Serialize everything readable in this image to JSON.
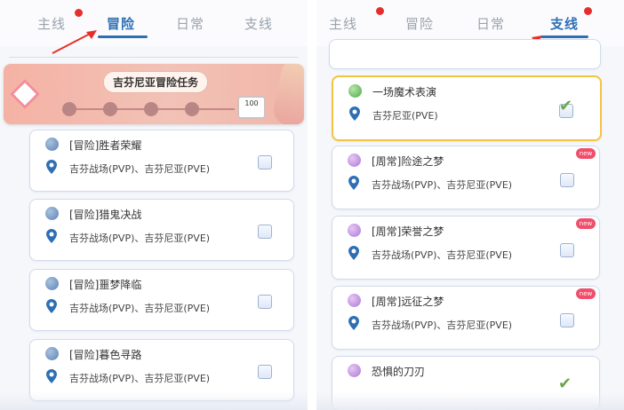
{
  "left": {
    "tabs": [
      {
        "label": "主线",
        "active": false,
        "red_dot": true
      },
      {
        "label": "冒险",
        "active": true,
        "red_dot": false
      },
      {
        "label": "日常",
        "active": false,
        "red_dot": false
      },
      {
        "label": "支线",
        "active": false,
        "red_dot": false
      }
    ],
    "banner": {
      "title": "吉芬尼亚冒险任务",
      "reward": "100"
    },
    "tasks": [
      {
        "title": "[冒险]胜者荣耀",
        "location": "吉芬战场(PVP)、吉芬尼亚(PVE)",
        "done": false
      },
      {
        "title": "[冒险]猎鬼决战",
        "location": "吉芬战场(PVP)、吉芬尼亚(PVE)",
        "done": false
      },
      {
        "title": "[冒险]噩梦降临",
        "location": "吉芬战场(PVP)、吉芬尼亚(PVE)",
        "done": false
      },
      {
        "title": "[冒险]暮色寻路",
        "location": "吉芬战场(PVP)、吉芬尼亚(PVE)",
        "done": false
      }
    ]
  },
  "right": {
    "tabs": [
      {
        "label": "主线",
        "active": false,
        "red_dot": true
      },
      {
        "label": "冒险",
        "active": false,
        "red_dot": false
      },
      {
        "label": "日常",
        "active": false,
        "red_dot": false
      },
      {
        "label": "支线",
        "active": true,
        "red_dot": true
      }
    ],
    "tasks": [
      {
        "title": "一场魔术表演",
        "location": "吉芬尼亚(PVE)",
        "done": true,
        "selected": true
      },
      {
        "title": "[周常]险途之梦",
        "location": "吉芬战场(PVP)、吉芬尼亚(PVE)",
        "done": false,
        "new": true
      },
      {
        "title": "[周常]荣誉之梦",
        "location": "吉芬战场(PVP)、吉芬尼亚(PVE)",
        "done": false,
        "new": true
      },
      {
        "title": "[周常]远征之梦",
        "location": "吉芬战场(PVP)、吉芬尼亚(PVE)",
        "done": false,
        "new": true
      },
      {
        "title": "恐惧的刀刃",
        "location": "",
        "done": true
      }
    ],
    "new_badge": "new"
  },
  "colors": {
    "accent": "#2e6fb4",
    "red_dot": "#e3302f",
    "arrow": "#e5302a",
    "selected_border": "#f3c443"
  }
}
